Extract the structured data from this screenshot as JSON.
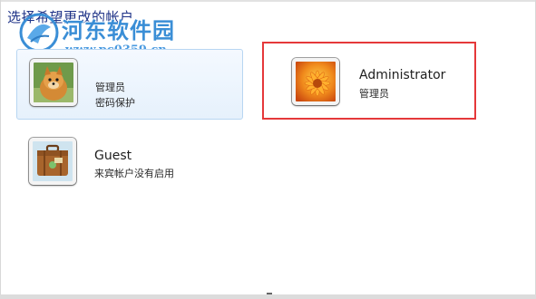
{
  "header": {
    "title": "选择希望更改的帐户"
  },
  "watermark": {
    "site_name": "河东软件园",
    "url": "www.pc0359.cn"
  },
  "accounts": [
    {
      "name": "",
      "type": "管理员",
      "detail": "密码保护",
      "avatar": "dog-avatar-icon",
      "highlighted": true
    },
    {
      "name": "Administrator",
      "type": "管理员",
      "detail": "",
      "avatar": "flower-avatar-icon",
      "selected_box": true
    },
    {
      "name": "Guest",
      "type": "来宾帐户没有启用",
      "detail": "",
      "avatar": "suitcase-avatar-icon"
    }
  ],
  "colors": {
    "heading": "#1e3287",
    "watermark": "#3a8ed6",
    "selection_border": "#e5383a",
    "hover_bg": "#e6f1fc"
  }
}
